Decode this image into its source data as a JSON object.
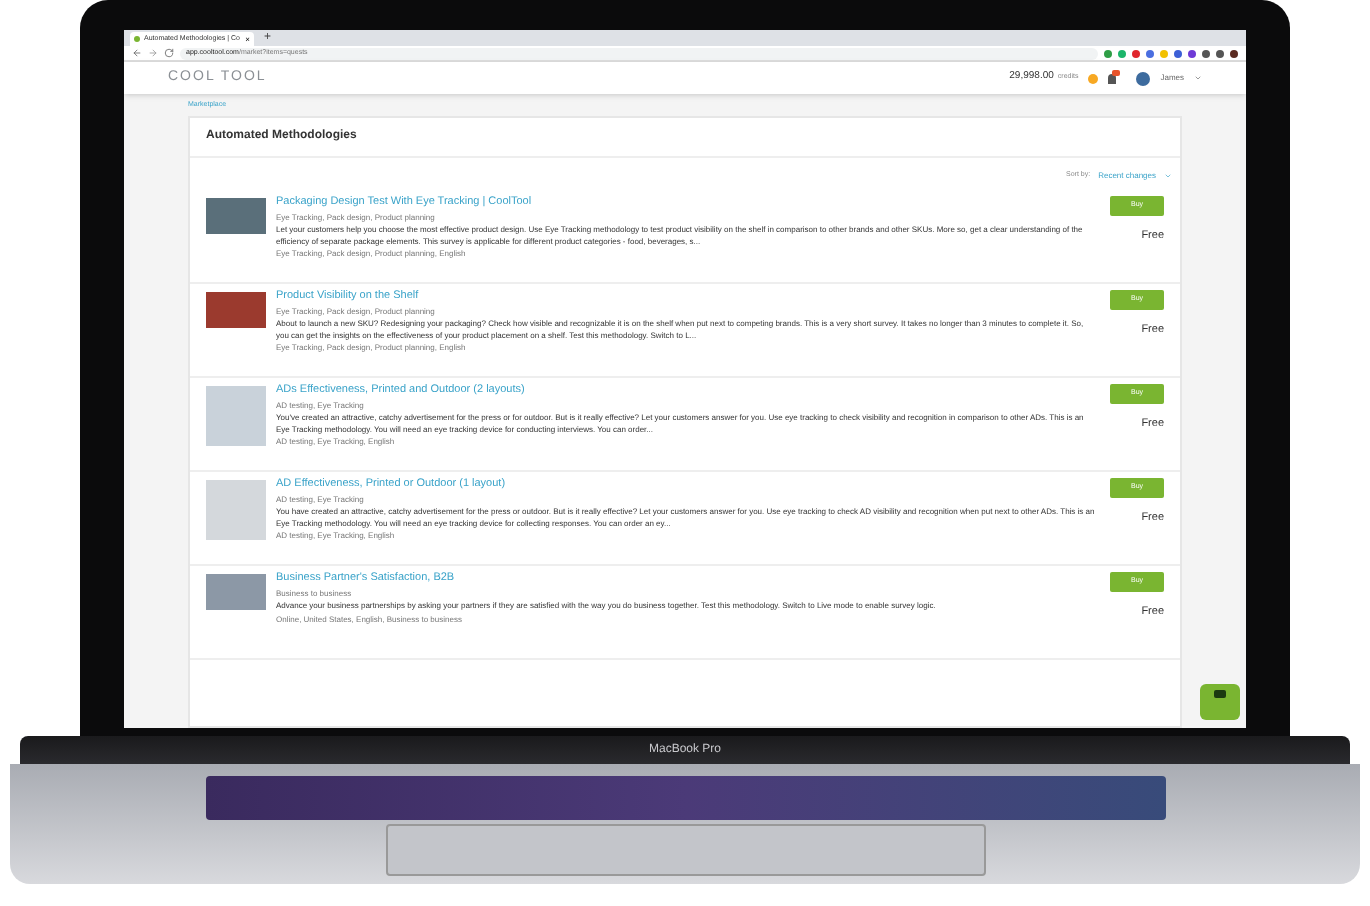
{
  "browser": {
    "tab_title": "Automated Methodologies | Co",
    "tab_close": "×",
    "new_tab": "+",
    "url_host": "app.cooltool.com",
    "url_path": "/market?items=quests"
  },
  "header": {
    "logo": "COOL TOOL",
    "credits": "29,998.00",
    "credits_label": "credits",
    "user": "James"
  },
  "breadcrumb": "Marketplace",
  "page_title": "Automated Methodologies",
  "sort": {
    "label": "Sort by:",
    "value": "Recent changes"
  },
  "items": [
    {
      "title": "Packaging Design Test With Eye Tracking | CoolTool",
      "tags": "Eye Tracking, Pack design, Product planning",
      "description": "Let your customers help you choose the most effective product design. Use Eye Tracking methodology to test product visibility on the shelf in comparison to other brands and other SKUs. More so, get a clear understanding of the efficiency of separate package elements. This survey is applicable for different product categories - food, beverages, s...",
      "meta": "Eye Tracking, Pack design, Product planning, English",
      "button": "Buy",
      "price": "Free"
    },
    {
      "title": "Product Visibility on the Shelf",
      "tags": "Eye Tracking, Pack design, Product planning",
      "description": "About to launch a new SKU? Redesigning your packaging? Check how visible and recognizable it is on the shelf when put next to competing brands. This is a very short survey. It takes no longer than 3 minutes to complete it. So, you can get the insights on the effectiveness of your product placement on a shelf. Test this methodology. Switch to L...",
      "meta": "Eye Tracking, Pack design, Product planning, English",
      "button": "Buy",
      "price": "Free"
    },
    {
      "title": "ADs Effectiveness, Printed and Outdoor (2 layouts)",
      "tags": "AD testing, Eye Tracking",
      "description": "You've created an attractive, catchy advertisement for the press or for outdoor. But is it really effective? Let your customers answer for you. Use eye tracking to check visibility and recognition in comparison to other ADs. This is an Eye Tracking methodology. You will need an eye tracking device for conducting interviews. You can order...",
      "meta": "AD testing, Eye Tracking, English",
      "button": "Buy",
      "price": "Free"
    },
    {
      "title": "AD Effectiveness, Printed or Outdoor (1 layout)",
      "tags": "AD testing, Eye Tracking",
      "description": "You have created an attractive, catchy advertisement for the press or outdoor. But is it really effective? Let your customers answer for you. Use eye tracking to check AD visibility and recognition when put next to other ADs. This is an Eye Tracking methodology. You will need an eye tracking device for collecting responses. You can order an ey...",
      "meta": "AD testing, Eye Tracking, English",
      "button": "Buy",
      "price": "Free"
    },
    {
      "title": "Business Partner's Satisfaction, B2B",
      "tags": "Business to business",
      "description": "Advance your business partnerships by asking your partners if they are satisfied with the way you do business together. Test this methodology. Switch to Live mode to enable survey logic.",
      "meta": "Online, United States, English, Business to business",
      "button": "Buy",
      "price": "Free"
    }
  ],
  "laptop_label": "MacBook Pro"
}
